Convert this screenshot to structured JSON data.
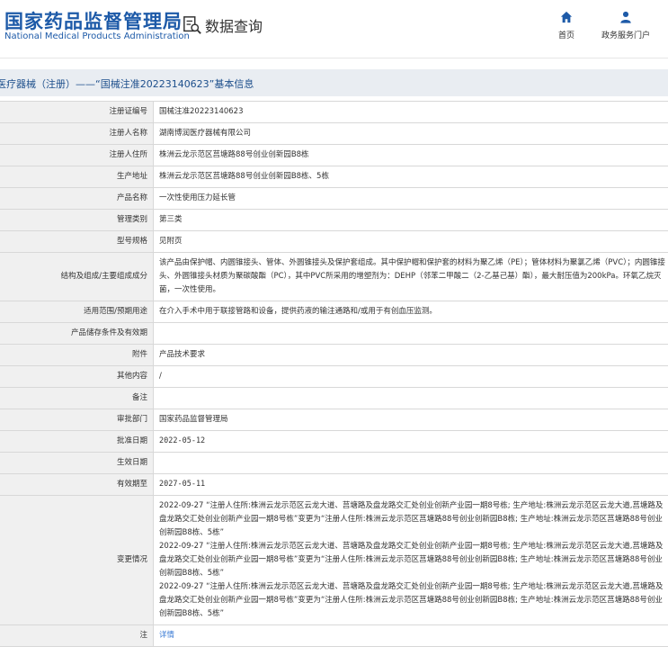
{
  "header": {
    "logo_cn": "国家药品监督管理局",
    "logo_en": "National Medical Products Administration",
    "search_label": "数据查询",
    "nav_home": "首页",
    "nav_portal": "政务服务门户"
  },
  "breadcrumb": "医疗器械（注册）——“国械注准20223140623”基本信息",
  "rows": [
    {
      "label": "注册证编号",
      "value": "国械注准20223140623"
    },
    {
      "label": "注册人名称",
      "value": "湖南博润医疗器械有限公司"
    },
    {
      "label": "注册人住所",
      "value": "株洲云龙示范区莒塘路88号创业创新园B8栋"
    },
    {
      "label": "生产地址",
      "value": "株洲云龙示范区莒塘路88号创业创新园B8栋、5栋"
    },
    {
      "label": "产品名称",
      "value": "一次性使用压力延长管"
    },
    {
      "label": "管理类别",
      "value": "第三类"
    },
    {
      "label": "型号规格",
      "value": "见附页"
    },
    {
      "label": "结构及组成/主要组成成分",
      "value": "该产品由保护帽、内圆锥接头、管体、外圆锥接头及保护套组成。其中保护帽和保护套的材料为聚乙烯（PE）；管体材料为聚氯乙烯（PVC）；内圆锥接头、外圆锥接头材质为聚碳酸酯（PC），其中PVC所采用的增塑剂为：DEHP（邻苯二甲酸二（2-乙基己基）酯），最大耐压值为200kPa。环氧乙烷灭菌，一次性使用。"
    },
    {
      "label": "适用范围/预期用途",
      "value": "在介入手术中用于联接管路和设备，提供药液的输注通路和/或用于有创血压监测。"
    },
    {
      "label": "产品储存条件及有效期",
      "value": ""
    },
    {
      "label": "附件",
      "value": "产品技术要求"
    },
    {
      "label": "其他内容",
      "value": "/"
    },
    {
      "label": "备注",
      "value": ""
    },
    {
      "label": "审批部门",
      "value": "国家药品监督管理局"
    },
    {
      "label": "批准日期",
      "value": "2022-05-12"
    },
    {
      "label": "生效日期",
      "value": ""
    },
    {
      "label": "有效期至",
      "value": "2027-05-11"
    },
    {
      "label": "变更情况",
      "value": ""
    },
    {
      "label": "注",
      "value": "详情"
    }
  ],
  "changes": [
    "2022-09-27 “注册人住所:株洲云龙示范区云龙大道、莒塘路及盘龙路交汇处创业创新产业园一期8号栋; 生产地址:株洲云龙示范区云龙大道,莒塘路及盘龙路交汇处创业创新产业园一期8号栋”变更为“注册人住所:株洲云龙示范区莒塘路88号创业创新园B8栋; 生产地址:株洲云龙示范区莒塘路88号创业创新园B8栋、5栋”",
    "2022-09-27 “注册人住所:株洲云龙示范区云龙大道、莒塘路及盘龙路交汇处创业创新产业园一期8号栋; 生产地址:株洲云龙示范区云龙大道,莒塘路及盘龙路交汇处创业创新产业园一期8号栋”变更为“注册人住所:株洲云龙示范区莒塘路88号创业创新园B8栋; 生产地址:株洲云龙示范区莒塘路88号创业创新园B8栋、5栋”",
    "2022-09-27 “注册人住所:株洲云龙示范区云龙大道、莒塘路及盘龙路交汇处创业创新产业园一期8号栋; 生产地址:株洲云龙示范区云龙大道,莒塘路及盘龙路交汇处创业创新产业园一期8号栋”变更为“注册人住所:株洲云龙示范区莒塘路88号创业创新园B8栋; 生产地址:株洲云龙示范区莒塘路88号创业创新园B8栋、5栋”"
  ],
  "icons": {
    "search": "document-search-icon",
    "home": "home-icon",
    "user": "user-icon"
  },
  "colors": {
    "brand": "#1d5aa8",
    "link": "#3b7bd4",
    "label_bg": "#f0f0f0",
    "crumb_bg": "#e9edf2"
  }
}
